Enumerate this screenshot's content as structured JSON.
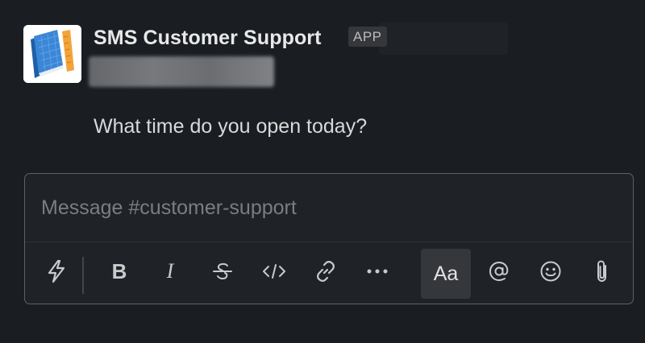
{
  "message": {
    "sender_name": "SMS Customer Support",
    "badge": "APP",
    "text": "What time do you open today?"
  },
  "composer": {
    "placeholder": "Message #customer-support",
    "value": "",
    "toolbar": {
      "shortcuts_icon": "lightning-icon",
      "bold_label": "B",
      "italic_label": "I",
      "strikethrough_icon": "strikethrough-icon",
      "code_icon": "code-icon",
      "link_icon": "link-icon",
      "more_icon": "ellipsis-icon",
      "formatting_label": "Aa",
      "mention_icon": "at-icon",
      "emoji_icon": "emoji-icon",
      "attach_icon": "paperclip-icon"
    }
  },
  "colors": {
    "background": "#1a1d21",
    "text_primary": "#e8e8e8",
    "badge_bg": "#35373b",
    "composer_border": "#5f6165",
    "avatar_blue": "#2f79c8",
    "avatar_orange": "#f2a33a"
  }
}
